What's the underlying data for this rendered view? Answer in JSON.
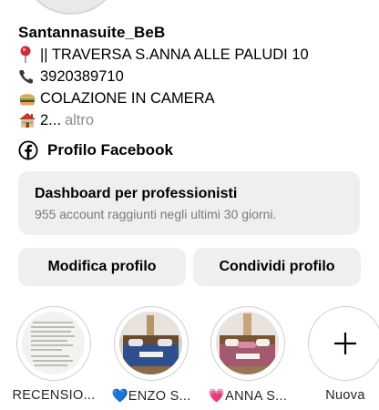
{
  "profile": {
    "username": "Santannasuite_BeB",
    "bio": [
      {
        "icon": "pin-icon",
        "text": "|| TRAVERSA S.ANNA ALLE PALUDI 10"
      },
      {
        "icon": "phone-icon",
        "text": "3920389710"
      },
      {
        "icon": "burger-icon",
        "text": "COLAZIONE IN CAMERA"
      },
      {
        "icon": "house-icon",
        "text": "2...",
        "more": "altro"
      }
    ],
    "facebook_link": "Profilo Facebook"
  },
  "dashboard": {
    "title": "Dashboard per professionisti",
    "subtitle": "955 account raggiunti negli ultimi 30 giorni."
  },
  "actions": {
    "edit_profile": "Modifica profilo",
    "share_profile": "Condividi profilo"
  },
  "highlights": [
    {
      "label": "RECENSIO...",
      "icon": "text-screenshot"
    },
    {
      "label": "💙ENZO S...",
      "icon": "bedroom-photo"
    },
    {
      "label": "💗ANNA S...",
      "icon": "bedroom-photo"
    },
    {
      "label": "Nuova",
      "icon": "plus-icon"
    }
  ],
  "colors": {
    "button_bg": "#efeff0",
    "muted_text": "#8e8e8e",
    "pin_red": "#d7263d",
    "facebook_black": "#000000"
  }
}
